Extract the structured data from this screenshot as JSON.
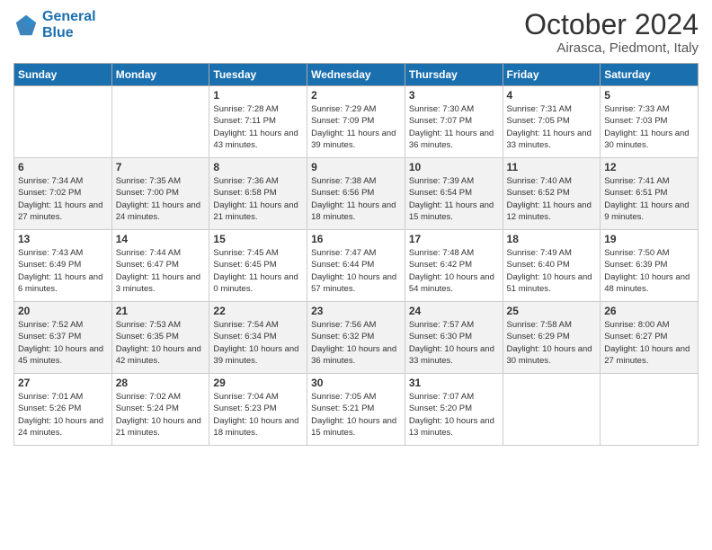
{
  "logo": {
    "line1": "General",
    "line2": "Blue"
  },
  "title": "October 2024",
  "location": "Airasca, Piedmont, Italy",
  "days_of_week": [
    "Sunday",
    "Monday",
    "Tuesday",
    "Wednesday",
    "Thursday",
    "Friday",
    "Saturday"
  ],
  "weeks": [
    [
      {
        "day": "",
        "sunrise": "",
        "sunset": "",
        "daylight": ""
      },
      {
        "day": "",
        "sunrise": "",
        "sunset": "",
        "daylight": ""
      },
      {
        "day": "1",
        "sunrise": "Sunrise: 7:28 AM",
        "sunset": "Sunset: 7:11 PM",
        "daylight": "Daylight: 11 hours and 43 minutes."
      },
      {
        "day": "2",
        "sunrise": "Sunrise: 7:29 AM",
        "sunset": "Sunset: 7:09 PM",
        "daylight": "Daylight: 11 hours and 39 minutes."
      },
      {
        "day": "3",
        "sunrise": "Sunrise: 7:30 AM",
        "sunset": "Sunset: 7:07 PM",
        "daylight": "Daylight: 11 hours and 36 minutes."
      },
      {
        "day": "4",
        "sunrise": "Sunrise: 7:31 AM",
        "sunset": "Sunset: 7:05 PM",
        "daylight": "Daylight: 11 hours and 33 minutes."
      },
      {
        "day": "5",
        "sunrise": "Sunrise: 7:33 AM",
        "sunset": "Sunset: 7:03 PM",
        "daylight": "Daylight: 11 hours and 30 minutes."
      }
    ],
    [
      {
        "day": "6",
        "sunrise": "Sunrise: 7:34 AM",
        "sunset": "Sunset: 7:02 PM",
        "daylight": "Daylight: 11 hours and 27 minutes."
      },
      {
        "day": "7",
        "sunrise": "Sunrise: 7:35 AM",
        "sunset": "Sunset: 7:00 PM",
        "daylight": "Daylight: 11 hours and 24 minutes."
      },
      {
        "day": "8",
        "sunrise": "Sunrise: 7:36 AM",
        "sunset": "Sunset: 6:58 PM",
        "daylight": "Daylight: 11 hours and 21 minutes."
      },
      {
        "day": "9",
        "sunrise": "Sunrise: 7:38 AM",
        "sunset": "Sunset: 6:56 PM",
        "daylight": "Daylight: 11 hours and 18 minutes."
      },
      {
        "day": "10",
        "sunrise": "Sunrise: 7:39 AM",
        "sunset": "Sunset: 6:54 PM",
        "daylight": "Daylight: 11 hours and 15 minutes."
      },
      {
        "day": "11",
        "sunrise": "Sunrise: 7:40 AM",
        "sunset": "Sunset: 6:52 PM",
        "daylight": "Daylight: 11 hours and 12 minutes."
      },
      {
        "day": "12",
        "sunrise": "Sunrise: 7:41 AM",
        "sunset": "Sunset: 6:51 PM",
        "daylight": "Daylight: 11 hours and 9 minutes."
      }
    ],
    [
      {
        "day": "13",
        "sunrise": "Sunrise: 7:43 AM",
        "sunset": "Sunset: 6:49 PM",
        "daylight": "Daylight: 11 hours and 6 minutes."
      },
      {
        "day": "14",
        "sunrise": "Sunrise: 7:44 AM",
        "sunset": "Sunset: 6:47 PM",
        "daylight": "Daylight: 11 hours and 3 minutes."
      },
      {
        "day": "15",
        "sunrise": "Sunrise: 7:45 AM",
        "sunset": "Sunset: 6:45 PM",
        "daylight": "Daylight: 11 hours and 0 minutes."
      },
      {
        "day": "16",
        "sunrise": "Sunrise: 7:47 AM",
        "sunset": "Sunset: 6:44 PM",
        "daylight": "Daylight: 10 hours and 57 minutes."
      },
      {
        "day": "17",
        "sunrise": "Sunrise: 7:48 AM",
        "sunset": "Sunset: 6:42 PM",
        "daylight": "Daylight: 10 hours and 54 minutes."
      },
      {
        "day": "18",
        "sunrise": "Sunrise: 7:49 AM",
        "sunset": "Sunset: 6:40 PM",
        "daylight": "Daylight: 10 hours and 51 minutes."
      },
      {
        "day": "19",
        "sunrise": "Sunrise: 7:50 AM",
        "sunset": "Sunset: 6:39 PM",
        "daylight": "Daylight: 10 hours and 48 minutes."
      }
    ],
    [
      {
        "day": "20",
        "sunrise": "Sunrise: 7:52 AM",
        "sunset": "Sunset: 6:37 PM",
        "daylight": "Daylight: 10 hours and 45 minutes."
      },
      {
        "day": "21",
        "sunrise": "Sunrise: 7:53 AM",
        "sunset": "Sunset: 6:35 PM",
        "daylight": "Daylight: 10 hours and 42 minutes."
      },
      {
        "day": "22",
        "sunrise": "Sunrise: 7:54 AM",
        "sunset": "Sunset: 6:34 PM",
        "daylight": "Daylight: 10 hours and 39 minutes."
      },
      {
        "day": "23",
        "sunrise": "Sunrise: 7:56 AM",
        "sunset": "Sunset: 6:32 PM",
        "daylight": "Daylight: 10 hours and 36 minutes."
      },
      {
        "day": "24",
        "sunrise": "Sunrise: 7:57 AM",
        "sunset": "Sunset: 6:30 PM",
        "daylight": "Daylight: 10 hours and 33 minutes."
      },
      {
        "day": "25",
        "sunrise": "Sunrise: 7:58 AM",
        "sunset": "Sunset: 6:29 PM",
        "daylight": "Daylight: 10 hours and 30 minutes."
      },
      {
        "day": "26",
        "sunrise": "Sunrise: 8:00 AM",
        "sunset": "Sunset: 6:27 PM",
        "daylight": "Daylight: 10 hours and 27 minutes."
      }
    ],
    [
      {
        "day": "27",
        "sunrise": "Sunrise: 7:01 AM",
        "sunset": "Sunset: 5:26 PM",
        "daylight": "Daylight: 10 hours and 24 minutes."
      },
      {
        "day": "28",
        "sunrise": "Sunrise: 7:02 AM",
        "sunset": "Sunset: 5:24 PM",
        "daylight": "Daylight: 10 hours and 21 minutes."
      },
      {
        "day": "29",
        "sunrise": "Sunrise: 7:04 AM",
        "sunset": "Sunset: 5:23 PM",
        "daylight": "Daylight: 10 hours and 18 minutes."
      },
      {
        "day": "30",
        "sunrise": "Sunrise: 7:05 AM",
        "sunset": "Sunset: 5:21 PM",
        "daylight": "Daylight: 10 hours and 15 minutes."
      },
      {
        "day": "31",
        "sunrise": "Sunrise: 7:07 AM",
        "sunset": "Sunset: 5:20 PM",
        "daylight": "Daylight: 10 hours and 13 minutes."
      },
      {
        "day": "",
        "sunrise": "",
        "sunset": "",
        "daylight": ""
      },
      {
        "day": "",
        "sunrise": "",
        "sunset": "",
        "daylight": ""
      }
    ]
  ]
}
